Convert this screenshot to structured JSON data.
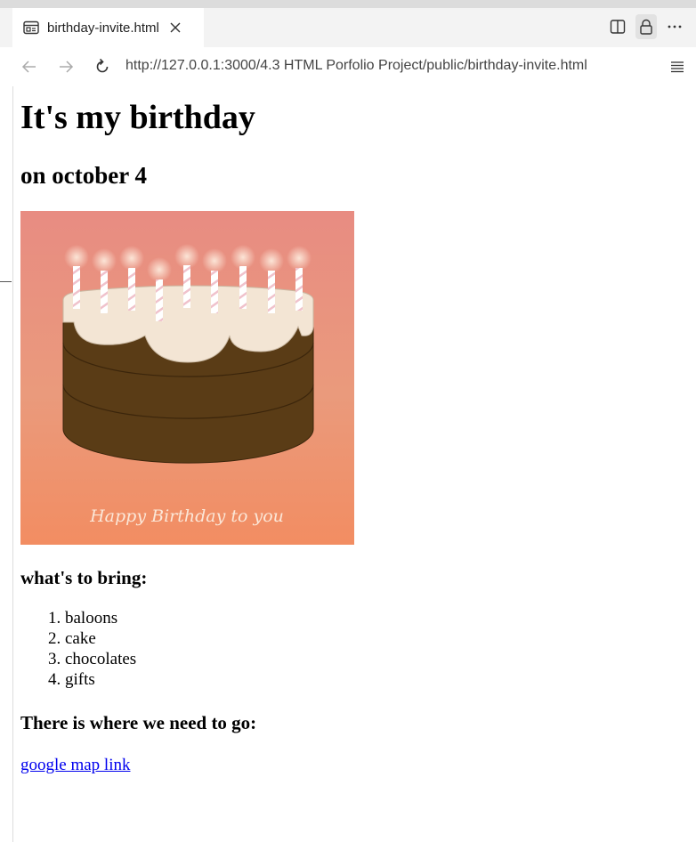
{
  "browser": {
    "tab_title": "birthday-invite.html",
    "url": "http://127.0.0.1:3000/4.3 HTML Porfolio Project/public/birthday-invite.html",
    "tab_icon": "page-icon",
    "icons": [
      "split-screen-icon",
      "lock-icon",
      "more-options-icon",
      "back-icon",
      "forward-icon",
      "refresh-icon",
      "menu-icon"
    ]
  },
  "page": {
    "title": "It's my birthday",
    "date": "on october 4",
    "image_caption": "Happy Birthday to you",
    "bring_heading": "what's to bring:",
    "bring_items": [
      "baloons",
      "cake",
      "chocolates",
      "gifts"
    ],
    "go_heading": "There is where we need to go:",
    "map_link_text": "google map link"
  },
  "colors": {
    "link": "#0000ee",
    "cake_bg_top": "#e88c82",
    "cake_bg_bottom": "#f28d62",
    "cake_brown": "#5a3c16",
    "icing": "#f3e5d4"
  }
}
